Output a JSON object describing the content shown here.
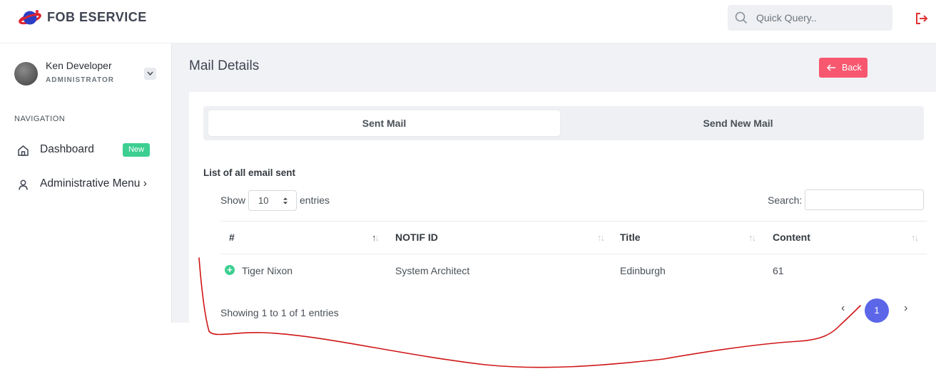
{
  "header": {
    "brand": "FOB ESERVICE",
    "logo_icon": "planet-logo-icon",
    "quick_query_placeholder": "Quick Query..",
    "logout_icon": "logout-icon",
    "logout_color": "#e03131"
  },
  "user": {
    "name": "Ken Developer",
    "role": "ADMINISTRATOR"
  },
  "sidebar": {
    "nav_heading": "NAVIGATION",
    "items": [
      {
        "label": "Dashboard",
        "icon": "home-icon",
        "badge": "New"
      },
      {
        "label": "Administrative Menu ›",
        "icon": "user-icon"
      }
    ]
  },
  "page": {
    "title": "Mail Details",
    "back_label": "Back",
    "accent_color": "#f7586f"
  },
  "tabs": [
    {
      "label": "Sent Mail",
      "active": true
    },
    {
      "label": "Send New Mail",
      "active": false
    }
  ],
  "list": {
    "caption": "List of all email sent",
    "show_label": "Show",
    "entries_label": "entries",
    "page_size": "10",
    "search_label": "Search:",
    "columns": [
      "#",
      "NOTIF ID",
      "Title",
      "Content"
    ],
    "rows": [
      [
        "Tiger Nixon",
        "System Architect",
        "Edinburgh",
        "61"
      ]
    ],
    "info": "Showing 1 to 1 of 1 entries",
    "pagination": {
      "prev": "‹",
      "current": "1",
      "next": "›"
    }
  }
}
